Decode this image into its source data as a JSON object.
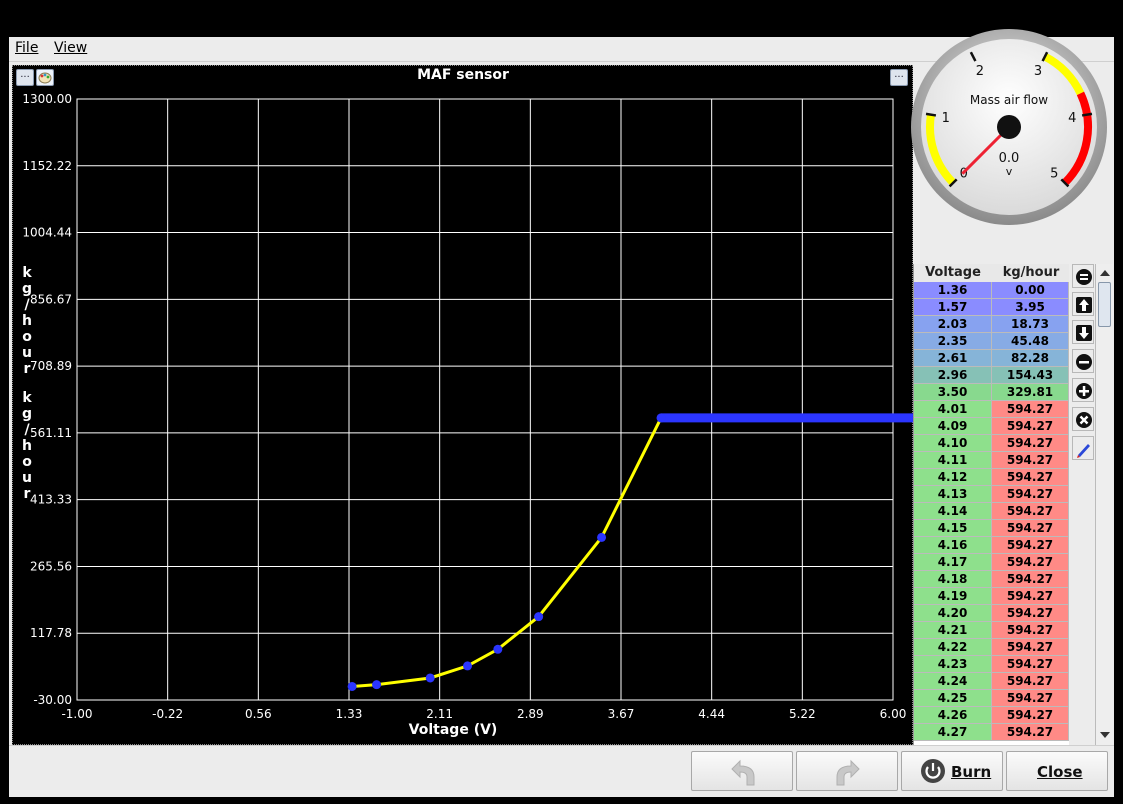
{
  "menu": {
    "file_label": "File",
    "view_label": "View"
  },
  "chart_panel": {
    "left_button_label": "...",
    "right_button_label": "..."
  },
  "chart_data": {
    "type": "line",
    "title": "MAF sensor",
    "xlabel": "Voltage (V)",
    "ylabel": "kg/hour",
    "ylabel_repeat": "kg/hour",
    "xlim": [
      -1.0,
      6.0
    ],
    "ylim": [
      -30.0,
      1300.0
    ],
    "x_ticks": [
      "-1.00",
      "-0.22",
      "0.56",
      "1.33",
      "2.11",
      "2.89",
      "3.67",
      "4.44",
      "5.22",
      "6.00"
    ],
    "y_ticks": [
      "-30.00",
      "117.78",
      "265.56",
      "413.33",
      "561.11",
      "708.89",
      "856.67",
      "1004.44",
      "1152.22",
      "1300.00"
    ],
    "grid": true,
    "line_color": "#ffff00",
    "point_color": "#2b35ff",
    "points": [
      [
        1.36,
        0.0
      ],
      [
        1.57,
        3.95
      ],
      [
        2.03,
        18.73
      ],
      [
        2.35,
        45.48
      ],
      [
        2.61,
        82.28
      ],
      [
        2.96,
        154.43
      ],
      [
        3.5,
        329.81
      ],
      [
        4.01,
        594.27
      ]
    ],
    "flat_segment": {
      "from_x": 4.01,
      "to_x": 6.0,
      "y": 594.27
    }
  },
  "gauge": {
    "title": "Mass air flow",
    "value": "0.0",
    "unit": "v",
    "tick_labels": [
      "0",
      "1",
      "2",
      "3",
      "4",
      "5"
    ],
    "min": 0,
    "max": 5,
    "needle_value": 0.0,
    "zones": [
      {
        "from": 0,
        "to": 1,
        "color": "#ffff00"
      },
      {
        "from": 3,
        "to": 3.7,
        "color": "#ffff00"
      },
      {
        "from": 3.7,
        "to": 5,
        "color": "#ff0000"
      }
    ]
  },
  "table": {
    "headers": [
      "Voltage",
      "kg/hour"
    ],
    "rows": [
      [
        "1.36",
        "0.00"
      ],
      [
        "1.57",
        "3.95"
      ],
      [
        "2.03",
        "18.73"
      ],
      [
        "2.35",
        "45.48"
      ],
      [
        "2.61",
        "82.28"
      ],
      [
        "2.96",
        "154.43"
      ],
      [
        "3.50",
        "329.81"
      ],
      [
        "4.01",
        "594.27"
      ],
      [
        "4.09",
        "594.27"
      ],
      [
        "4.10",
        "594.27"
      ],
      [
        "4.11",
        "594.27"
      ],
      [
        "4.12",
        "594.27"
      ],
      [
        "4.13",
        "594.27"
      ],
      [
        "4.14",
        "594.27"
      ],
      [
        "4.15",
        "594.27"
      ],
      [
        "4.16",
        "594.27"
      ],
      [
        "4.17",
        "594.27"
      ],
      [
        "4.18",
        "594.27"
      ],
      [
        "4.19",
        "594.27"
      ],
      [
        "4.20",
        "594.27"
      ],
      [
        "4.21",
        "594.27"
      ],
      [
        "4.22",
        "594.27"
      ],
      [
        "4.23",
        "594.27"
      ],
      [
        "4.24",
        "594.27"
      ],
      [
        "4.25",
        "594.27"
      ],
      [
        "4.26",
        "594.27"
      ],
      [
        "4.27",
        "594.27"
      ]
    ],
    "row_colors": [
      [
        "#8a8cff",
        "#8a8cff"
      ],
      [
        "#8a8cff",
        "#8a8cff"
      ],
      [
        "#87a2f0",
        "#87a2f0"
      ],
      [
        "#87abe5",
        "#87abe5"
      ],
      [
        "#86b4d8",
        "#86b4d8"
      ],
      [
        "#86c1b6",
        "#86c1b6"
      ],
      [
        "#88d98e",
        "#88d98e"
      ]
    ],
    "default_left_color": "#8ee08c",
    "default_right_color": "#ff8a86"
  },
  "tools": [
    "equal-icon",
    "arrow-up-icon",
    "arrow-down-icon",
    "minus-icon",
    "plus-icon",
    "cross-icon",
    "pen-icon"
  ],
  "bottom": {
    "burn_label": "Burn",
    "close_label": "Close"
  }
}
